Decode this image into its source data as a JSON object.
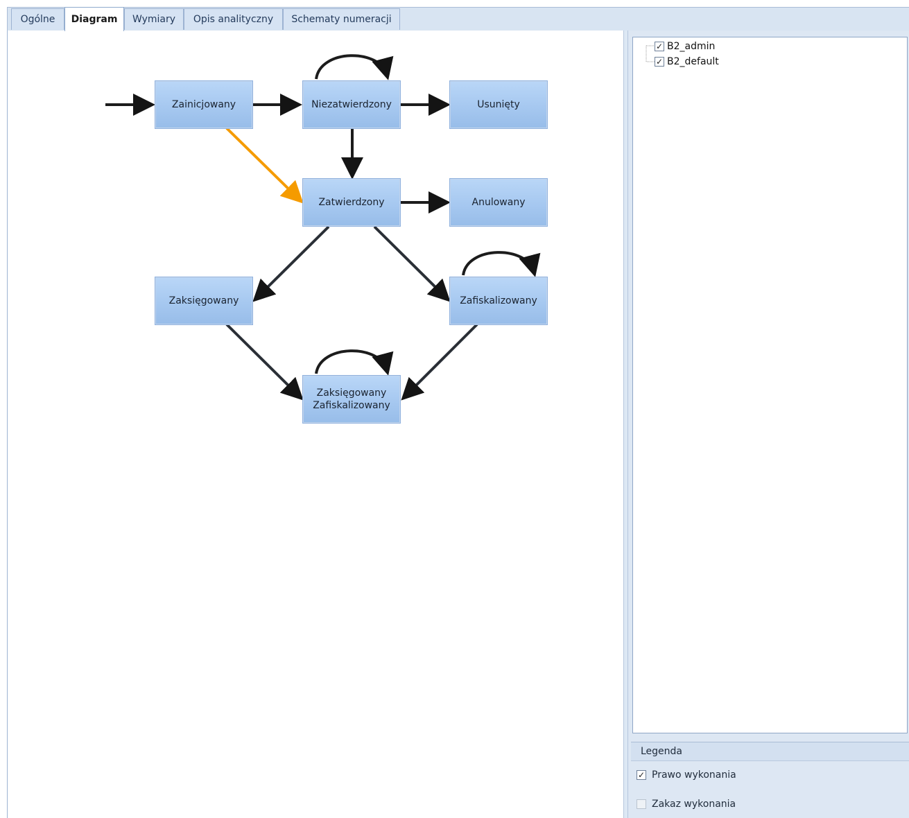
{
  "tabs": [
    {
      "label": "Ogólne"
    },
    {
      "label": "Diagram"
    },
    {
      "label": "Wymiary"
    },
    {
      "label": "Opis analityczny"
    },
    {
      "label": "Schematy numeracji"
    }
  ],
  "diagram": {
    "nodes": {
      "zainicjowany": {
        "label": "Zainicjowany"
      },
      "niezatwierdzony": {
        "label": "Niezatwierdzony"
      },
      "usuniety": {
        "label": "Usunięty"
      },
      "zatwierdzony": {
        "label": "Zatwierdzony"
      },
      "anulowany": {
        "label": "Anulowany"
      },
      "zaksiegowany": {
        "label": "Zaksięgowany"
      },
      "zafiskalizowany": {
        "label": "Zafiskalizowany"
      },
      "zaksiegowany_zafiskalizowany": {
        "line1": "Zaksięgowany",
        "line2": "Zafiskalizowany"
      }
    },
    "colors": {
      "edge": "#1c1c1c",
      "highlight_edge": "#f59b00",
      "node_fill": "#a9cbf1"
    }
  },
  "tree": {
    "items": [
      {
        "label": "B2_admin",
        "checked": true
      },
      {
        "label": "B2_default",
        "checked": true
      }
    ]
  },
  "legend": {
    "title": "Legenda",
    "items": [
      {
        "label": "Prawo wykonania",
        "checked": true
      },
      {
        "label": "Zakaz wykonania",
        "checked": false
      }
    ]
  }
}
